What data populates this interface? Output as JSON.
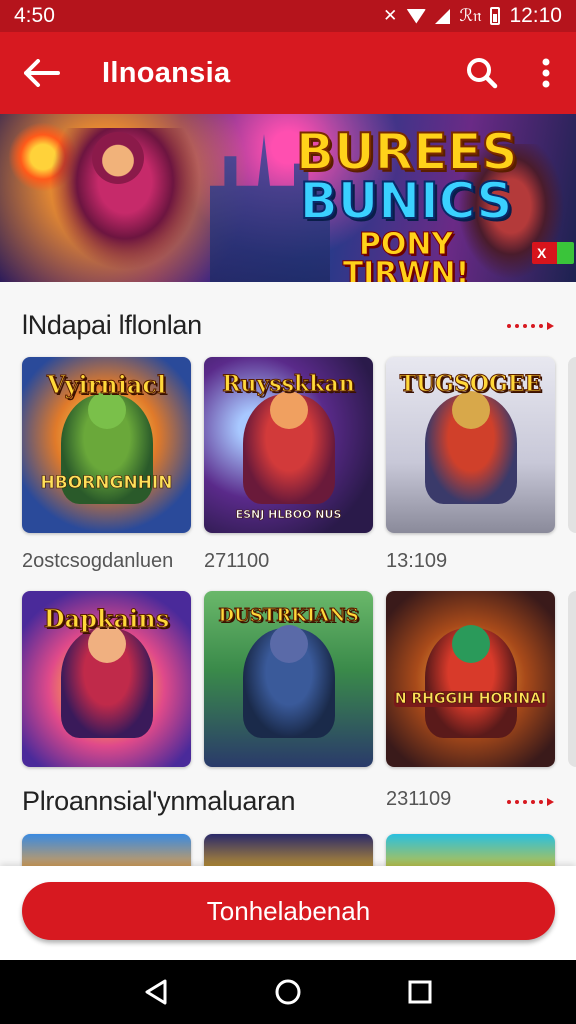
{
  "status_bar": {
    "time_left": "4:50",
    "time_right": "12:10",
    "signal_text": "ℛ𝔫"
  },
  "app_bar": {
    "title": "Ilnoansia"
  },
  "banner": {
    "line1": "BUREES",
    "line2": "BUNICS",
    "line3": "PONY TIRWN!",
    "badge": "X"
  },
  "section1": {
    "title": "lNdapai lflonlan",
    "row1": [
      {
        "title": "Vyirniacl",
        "subtitle": "HBORNGNHIN",
        "colors": [
          "#f2a23a",
          "#3a6ab8"
        ]
      },
      {
        "title": "Ruysskkan",
        "subtitle": "ESNJ HLBOO NUS",
        "colors": [
          "#5a2a8a",
          "#c93a4a"
        ]
      },
      {
        "title": "TUGSOGEE",
        "subtitle": "",
        "colors": [
          "#d8d8e0",
          "#c43a2a"
        ]
      }
    ],
    "captions": [
      "2ostcsogdanluen",
      "271100",
      "13:109"
    ],
    "row2": [
      {
        "title": "Dapkains",
        "subtitle": "",
        "colors": [
          "#f2a23a",
          "#7a2a9a"
        ]
      },
      {
        "title": "DUSTRKIANS",
        "subtitle": "",
        "colors": [
          "#2a7a4a",
          "#3a2a6a"
        ]
      },
      {
        "title": "",
        "subtitle": "N RHGGIH HORINAI",
        "colors": [
          "#a84a1a",
          "#5a2a2a"
        ]
      }
    ]
  },
  "section2": {
    "title": "Plroannsial'ynmaluaran",
    "count": "231109"
  },
  "cta": {
    "label": "Tonhelabenah"
  }
}
